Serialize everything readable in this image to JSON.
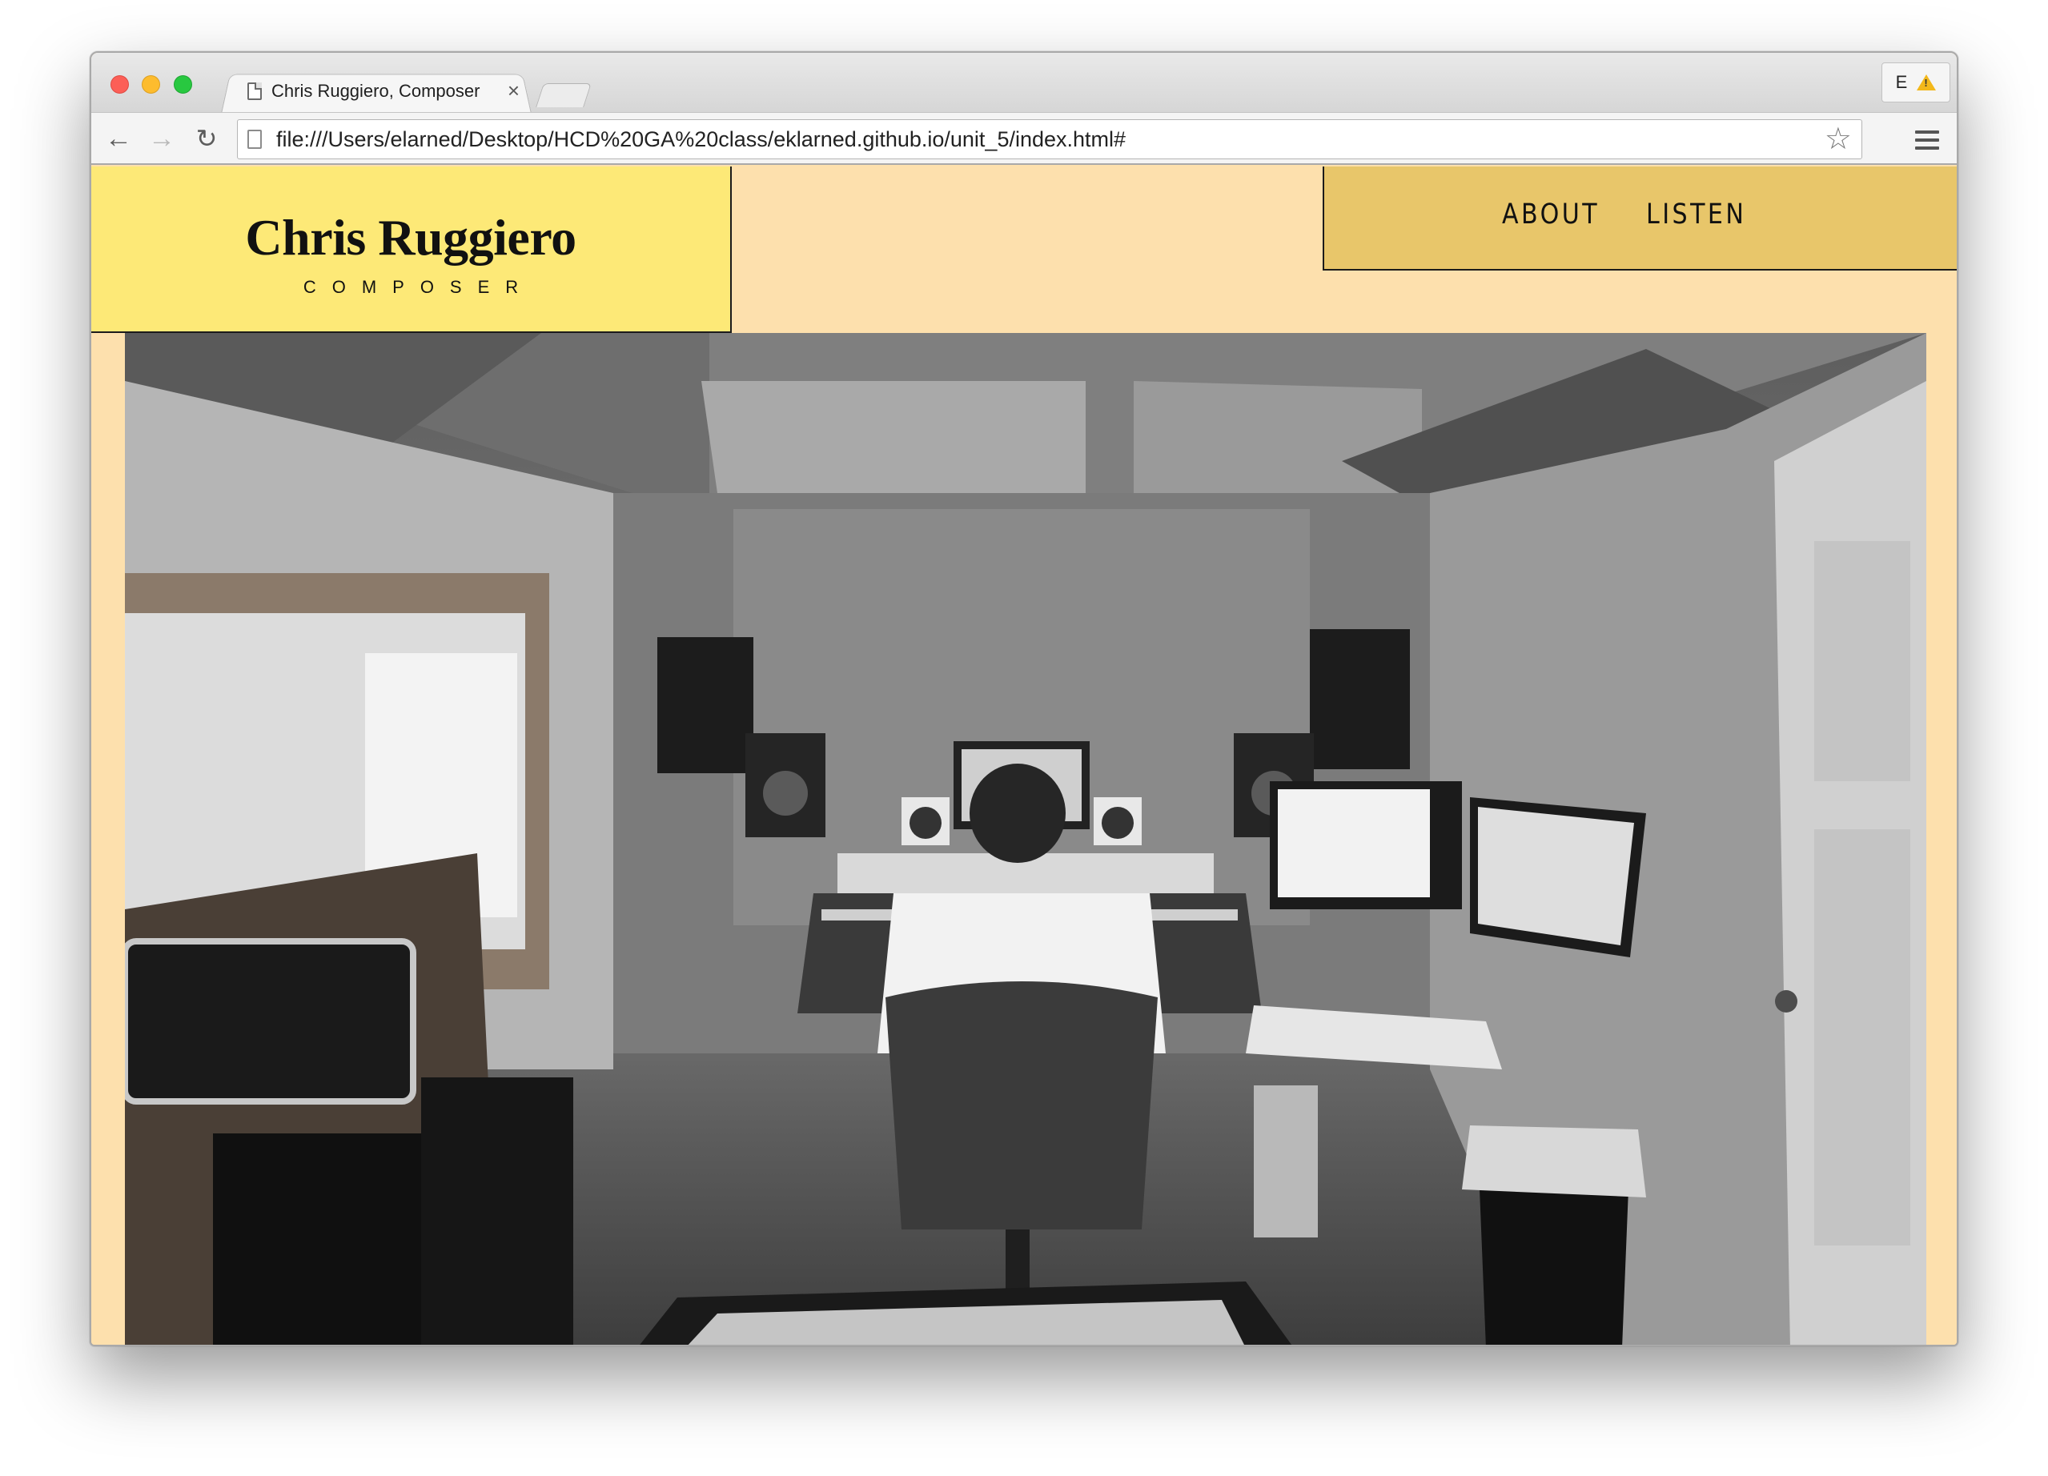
{
  "browser": {
    "tab": {
      "title": "Chris Ruggiero, Composer",
      "close_glyph": "×"
    },
    "extension": {
      "label": "E"
    },
    "address_bar": {
      "url": "file:///Users/elarned/Desktop/HCD%20GA%20class/eklarned.github.io/unit_5/index.html#"
    },
    "nav": {
      "back": "←",
      "forward": "→",
      "reload": "↻",
      "star": "☆"
    }
  },
  "site": {
    "brand": {
      "name": "Chris Ruggiero",
      "tagline": "COMPOSER"
    },
    "nav": [
      {
        "label": "ABOUT"
      },
      {
        "label": "LISTEN"
      }
    ]
  },
  "colors": {
    "page_background": "#fde0ad",
    "brand_box": "#fde977",
    "nav_box": "#e8c66a"
  }
}
